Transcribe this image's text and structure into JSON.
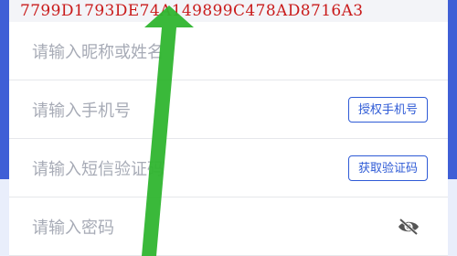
{
  "token": "7799D1793DE74A149899C478AD8716A3",
  "fields": [
    {
      "placeholder": "请输入昵称或姓名"
    },
    {
      "placeholder": "请输入手机号",
      "button": "授权手机号"
    },
    {
      "placeholder": "请输入短信验证码",
      "button": "获取验证码"
    },
    {
      "placeholder": "请输入密码",
      "icon": "eye-off-icon"
    }
  ],
  "colors": {
    "brand_blue": "#3f5fd6",
    "button_blue": "#2f5bd6",
    "token_red": "#c91b1b",
    "arrow_green": "#2fb52f"
  }
}
